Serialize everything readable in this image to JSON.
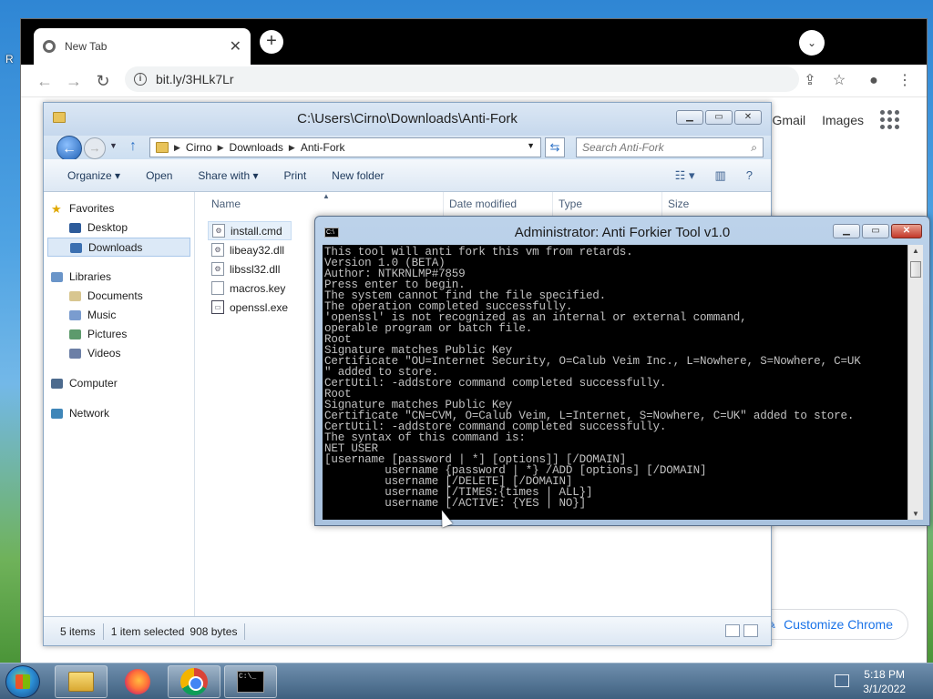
{
  "desktop": {
    "label_left": "R"
  },
  "chrome": {
    "tab_title": "New Tab",
    "tab_close": "✕",
    "new_tab": "+",
    "tab_menu": "⌄",
    "url": "bit.ly/3HLk7Lr",
    "links": {
      "gmail": "Gmail",
      "images": "Images"
    },
    "customize_label": "Customize Chrome"
  },
  "explorer": {
    "title": "C:\\Users\\Cirno\\Downloads\\Anti-Fork",
    "breadcrumbs": [
      "Cirno",
      "Downloads",
      "Anti-Fork"
    ],
    "search_placeholder": "Search Anti-Fork",
    "toolbar": {
      "organize": "Organize ▾",
      "open": "Open",
      "share": "Share with ▾",
      "print": "Print",
      "new_folder": "New folder"
    },
    "nav": {
      "favorites": "Favorites",
      "desktop": "Desktop",
      "downloads": "Downloads",
      "libraries": "Libraries",
      "documents": "Documents",
      "music": "Music",
      "pictures": "Pictures",
      "videos": "Videos",
      "computer": "Computer",
      "network": "Network"
    },
    "columns": {
      "name": "Name",
      "date": "Date modified",
      "type": "Type",
      "size": "Size"
    },
    "files": [
      {
        "name": "install.cmd",
        "selected": true
      },
      {
        "name": "libeay32.dll",
        "selected": false
      },
      {
        "name": "libssl32.dll",
        "selected": false
      },
      {
        "name": "macros.key",
        "selected": false
      },
      {
        "name": "openssl.exe",
        "selected": false
      }
    ],
    "status": {
      "count": "5 items",
      "selected": "1 item selected",
      "size": "908 bytes"
    }
  },
  "console": {
    "title": "Administrator:  Anti Forkier Tool v1.0",
    "lines": [
      "This tool will anti fork this vm from retards.",
      "Version 1.0 (BETA)",
      "Author: NTKRNLMP#7859",
      "Press enter to begin.",
      "The system cannot find the file specified.",
      "The operation completed successfully.",
      "'openssl' is not recognized as an internal or external command,",
      "operable program or batch file.",
      "Root",
      "Signature matches Public Key",
      "Certificate \"OU=Internet Security, O=Calub Veim Inc., L=Nowhere, S=Nowhere, C=UK",
      "\" added to store.",
      "CertUtil: -addstore command completed successfully.",
      "Root",
      "Signature matches Public Key",
      "Certificate \"CN=CVM, O=Calub Veim, L=Internet, S=Nowhere, C=UK\" added to store.",
      "CertUtil: -addstore command completed successfully.",
      "The syntax of this command is:",
      "",
      "NET USER",
      "[username [password | *] [options]] [/DOMAIN]",
      "         username {password | *} /ADD [options] [/DOMAIN]",
      "         username [/DELETE] [/DOMAIN]",
      "         username [/TIMES:{times | ALL}]",
      "         username [/ACTIVE: {YES | NO}]"
    ]
  },
  "taskbar": {
    "time": "5:18 PM",
    "date": "3/1/2022"
  }
}
